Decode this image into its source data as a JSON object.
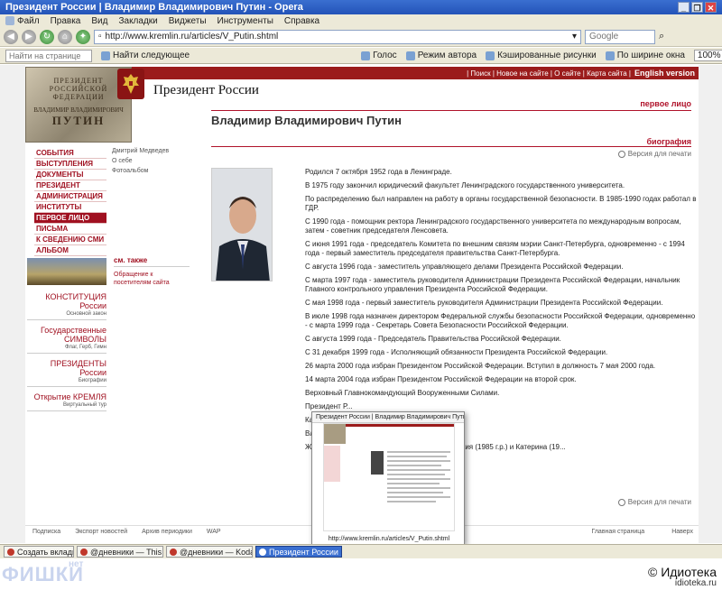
{
  "window": {
    "title": "Президент России | Владимир Владимирович Путин - Opera",
    "buttons": [
      "_",
      "❐",
      "✕"
    ]
  },
  "menu": [
    "Файл",
    "Правка",
    "Вид",
    "Закладки",
    "Виджеты",
    "Инструменты",
    "Справка"
  ],
  "address": {
    "url": "http://www.kremlin.ru/articles/V_Putin.shtml",
    "search_placeholder": "Google"
  },
  "toolbar2": {
    "find_placeholder": "Найти на странице",
    "find_next": "Найти следующее",
    "voice": "Голос",
    "author_mode": "Режим автора",
    "cached_images": "Кэшированные рисунки",
    "fit_width": "По ширине окна",
    "zoom": "100%"
  },
  "site": {
    "top_links": "| Поиск | Новое на сайте | О сайте | Карта сайта |",
    "lang": "English version",
    "title": "Президент России",
    "plaque": {
      "l1": "ПРЕЗИДЕНТ",
      "l2": "РОССИЙСКОЙ ФЕДЕРАЦИИ",
      "l3": "ВЛАДИМИР ВЛАДИМИРОВИЧ",
      "l4": "ПУТИН"
    },
    "section_first": "первое лицо",
    "section_bio": "биография",
    "person_name": "Владимир Владимирович Путин",
    "print": "Версия для печати"
  },
  "left_nav": [
    {
      "label": "СОБЫТИЯ",
      "active": false
    },
    {
      "label": "ВЫСТУПЛЕНИЯ",
      "active": false
    },
    {
      "label": "ДОКУМЕНТЫ",
      "active": false
    },
    {
      "label": "ПРЕЗИДЕНТ",
      "active": false
    },
    {
      "label": "АДМИНИСТРАЦИЯ",
      "active": false
    },
    {
      "label": "ИНСТИТУТЫ",
      "active": false
    },
    {
      "label": "ПЕРВОЕ ЛИЦО",
      "active": true
    },
    {
      "label": "ПИСЬМА",
      "active": false
    },
    {
      "label": "К СВЕДЕНИЮ СМИ",
      "active": false
    },
    {
      "label": "АЛЬБОМ",
      "active": false
    }
  ],
  "sub_nav": [
    "Дмитрий Медведев",
    "О себе",
    "Фотоальбом"
  ],
  "see_also": {
    "header": "см. также",
    "link": "Обращение к посетителям сайта"
  },
  "left_nav2": [
    {
      "big": "КОНСТИТУЦИЯ России",
      "small": "Основной закон"
    },
    {
      "big": "Государственные СИМВОЛЫ",
      "small": "Флаг, Герб, Гимн"
    },
    {
      "big": "ПРЕЗИДЕНТЫ России",
      "small": "Биографии"
    },
    {
      "big": "Открытие КРЕМЛЯ",
      "small": "Виртуальный тур"
    }
  ],
  "bio": [
    "Родился 7 октября 1952 года в Ленинграде.",
    "В 1975 году закончил юридический факультет Ленинградского государственного университета.",
    "По распределению был направлен на работу в органы государственной безопасности. В 1985-1990 годах работал в ГДР.",
    "С 1990 года - помощник ректора Ленинградского государственного университета по международным вопросам, затем - советник председателя Ленсовета.",
    "С июня 1991 года - председатель Комитета по внешним связям мэрии Санкт-Петербурга, одновременно - с 1994 года - первый заместитель председателя правительства Санкт-Петербурга.",
    "С августа 1996 года - заместитель управляющего делами Президента Российской Федерации.",
    "С марта 1997 года - заместитель руководителя Администрации Президента Российской Федерации, начальник Главного контрольного управления Президента Российской Федерации.",
    "С мая 1998 года - первый заместитель руководителя Администрации Президента Российской Федерации.",
    "В июле 1998 года назначен директором Федеральной службы безопасности Российской Федерации, одновременно - с марта 1999 года - Секретарь Совета Безопасности Российской Федерации.",
    "С августа 1999 года - Председатель Правительства Российской Федерации.",
    "С 31 декабря 1999 года - Исполняющий обязанности Президента Российской Федерации.",
    "26 марта 2000 года избран Президентом Российской Федерации. Вступил в должность 7 мая 2000 года.",
    "14 марта 2004 года избран Президентом Российской Федерации на второй срок.",
    "Верховный Главнокомандующий Вооруженными Силами."
  ],
  "bio_partial": [
    "Президент Р...",
    "Ка...",
    "Вл...",
    "Же... В семье Путиных двое детей: дочери Мария (1985 г.р.) и Катерина (19..."
  ],
  "footer": {
    "left": [
      "Подписка",
      "Экспорт новостей",
      "Архив периодики",
      "WAP"
    ],
    "right": [
      "Главная страница",
      "Наверх"
    ]
  },
  "preview": {
    "title": "Президент России | Владимир Владимирович Путин",
    "url": "http://www.kremlin.ru/articles/V_Putin.shtml"
  },
  "taskbar": [
    {
      "label": "Создать вкладку",
      "active": false
    },
    {
      "label": "@дневники — This gam...",
      "active": false
    },
    {
      "label": "@дневники — Kodai Ha...",
      "active": false
    },
    {
      "label": "Президент России | Вла...",
      "active": true
    }
  ],
  "watermark": {
    "fishki": "ФИШКИ",
    "net": "нет",
    "idioteka": "© Идиотека",
    "idioteka_url": "idioteka.ru"
  }
}
